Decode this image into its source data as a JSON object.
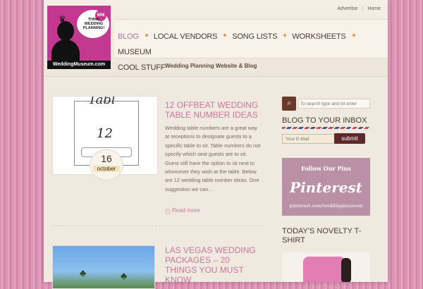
{
  "header": {
    "top_links": [
      "Advertise",
      "Home"
    ],
    "logo": {
      "bubble_badge": "WM",
      "bubble_text": "THINK WEDDING PLANNING!",
      "site_url": "WeddingMuseum.com"
    },
    "nav": [
      {
        "label": "BLOG",
        "active": true
      },
      {
        "label": "LOCAL VENDORS",
        "active": false
      },
      {
        "label": "SONG LISTS",
        "active": false
      },
      {
        "label": "WORKSHEETS",
        "active": false
      },
      {
        "label": "MUSEUM",
        "active": false
      },
      {
        "label": "COOL STUFF",
        "active": false
      }
    ],
    "tagline": "Wedding Planning Website & Blog"
  },
  "posts": [
    {
      "image_text_top": "Tabl",
      "image_text_number": "12",
      "date_day": "16",
      "date_month": "october",
      "title": "12 OFFBEAT WEDDING TABLE NUMBER IDEAS",
      "excerpt": "Wedding table numbers are a great way at receptions to designate guests to a specific table to sit. Table numbers do not specify which seat guests are to sit. Guest still have the option to sit next to whomever they wish at the table. Below are 12 wedding table number ideas. One suggestion we can…",
      "read_more": "Read more"
    },
    {
      "title": "LAS VEGAS WEDDING PACKAGES – 20 THINGS YOU MUST KNOW"
    }
  ],
  "sidebar": {
    "search_placeholder": "To search type and hit enter",
    "inbox_title": "BLOG TO YOUR INBOX",
    "email_placeholder": "Your E-Mail",
    "submit_label": "submit",
    "pinterest": {
      "follow_text": "Follow Our Pins",
      "logo_text": "Pinterest",
      "url_text": "pinterest.com/weddingmuseum"
    },
    "novelty_title": "TODAY'S NOVELTY T-SHIRT"
  },
  "colors": {
    "accent_pink": "#c7779e",
    "nav_dot": "#e3a13b",
    "submit_bg": "#5c2a2a",
    "pinterest_bg": "#b990a5"
  }
}
